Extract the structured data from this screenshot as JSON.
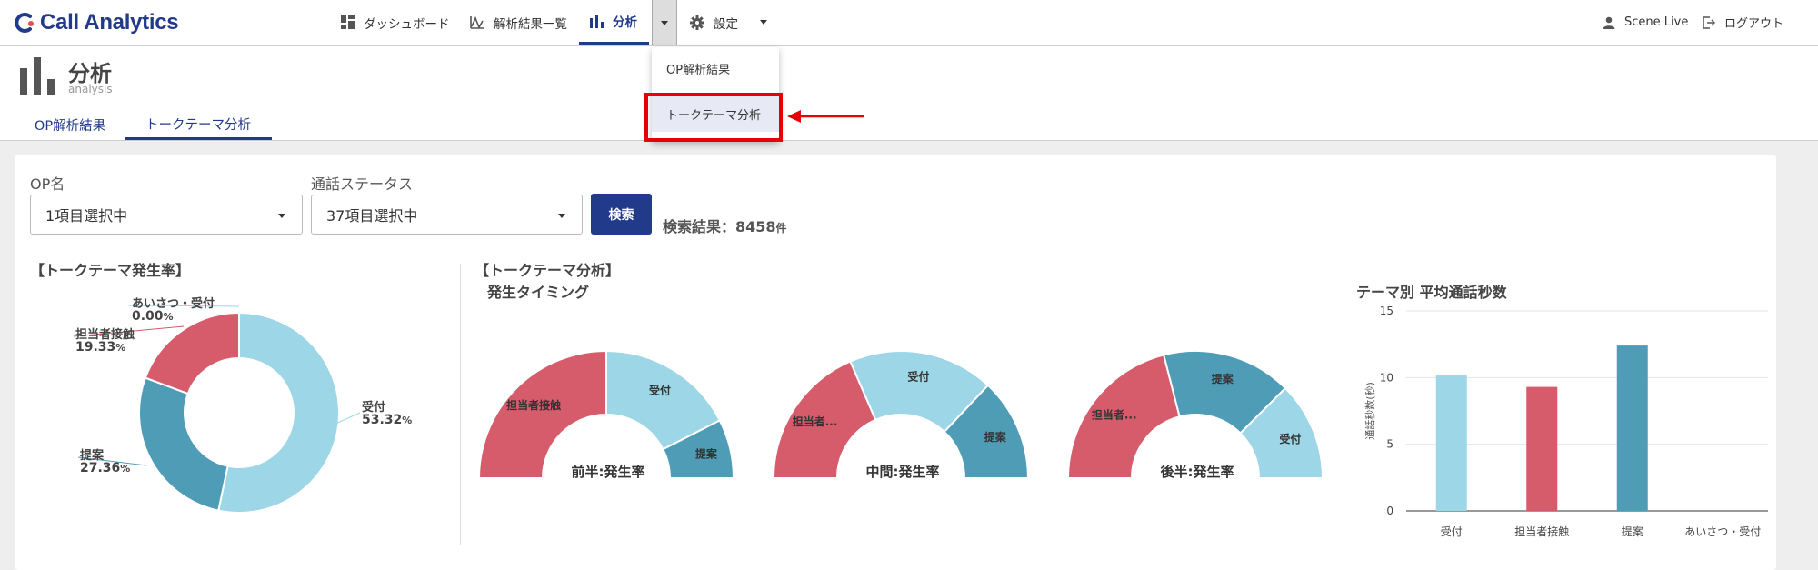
{
  "app": {
    "title": "Call Analytics"
  },
  "nav": {
    "items": [
      {
        "label": "ダッシュボード",
        "icon": "dashboard-icon"
      },
      {
        "label": "解析結果一覧",
        "icon": "line-chart-icon"
      },
      {
        "label": "分析",
        "icon": "bar-chart-icon",
        "active": true
      },
      {
        "label": "設定",
        "icon": "gear-icon"
      }
    ],
    "user": "Scene Live",
    "logout": "ログアウト"
  },
  "page": {
    "title": "分析",
    "subtitle": "analysis",
    "tabs": [
      {
        "label": "OP解析結果"
      },
      {
        "label": "トークテーマ分析",
        "active": true
      }
    ]
  },
  "dropdown": {
    "items": [
      {
        "label": "OP解析結果"
      },
      {
        "label": "トークテーマ分析",
        "selected": true
      }
    ]
  },
  "filters": {
    "op_label": "OP名",
    "op_value": "1項目選択中",
    "status_label": "通話ステータス",
    "status_value": "37項目選択中",
    "search_button": "検索",
    "result_prefix": "検索結果：",
    "result_count": "8458",
    "result_unit": "件"
  },
  "colors": {
    "accent": "#223a8a",
    "light_blue": "#9dd6e6",
    "red": "#d65c6b",
    "teal": "#4e9cb6",
    "highlight_red": "#e5000a"
  },
  "chart_data": [
    {
      "type": "pie",
      "title": "【トークテーマ発生率】",
      "donut": true,
      "slices": [
        {
          "name": "受付",
          "value": 53.32,
          "label": "53.32",
          "color": "#9dd6e6"
        },
        {
          "name": "提案",
          "value": 27.36,
          "label": "27.36",
          "color": "#4e9cb6"
        },
        {
          "name": "担当者接触",
          "value": 19.33,
          "label": "19.33",
          "color": "#d65c6b"
        },
        {
          "name": "あいさつ・受付",
          "value": 0.0,
          "label": "0.00",
          "color": "#9dd6e6"
        }
      ],
      "unit": "%"
    },
    {
      "type": "pie",
      "section_title": "【トークテーマ分析】",
      "title": "発生タイミング",
      "half_donut": true,
      "charts": [
        {
          "label": "前半:発生率",
          "slices": [
            {
              "name": "担当者接触",
              "label": "担当者接触",
              "value": 50,
              "color": "#d65c6b"
            },
            {
              "name": "受付",
              "label": "受付",
              "value": 35,
              "color": "#9dd6e6"
            },
            {
              "name": "提案",
              "label": "提案",
              "value": 15,
              "color": "#4e9cb6"
            }
          ]
        },
        {
          "label": "中間:発生率",
          "slices": [
            {
              "name": "担当者接触",
              "label": "担当者...",
              "value": 37,
              "color": "#d65c6b"
            },
            {
              "name": "受付",
              "label": "受付",
              "value": 37,
              "color": "#9dd6e6"
            },
            {
              "name": "提案",
              "label": "提案",
              "value": 26,
              "color": "#4e9cb6"
            }
          ]
        },
        {
          "label": "後半:発生率",
          "slices": [
            {
              "name": "担当者接触",
              "label": "担当者...",
              "value": 42,
              "color": "#d65c6b"
            },
            {
              "name": "提案",
              "label": "提案",
              "value": 33,
              "color": "#4e9cb6"
            },
            {
              "name": "受付",
              "label": "受付",
              "value": 25,
              "color": "#9dd6e6"
            }
          ]
        }
      ]
    },
    {
      "type": "bar",
      "title": "テーマ別 平均通話秒数",
      "ylabel": "通話秒数(秒)",
      "categories": [
        "受付",
        "担当者接触",
        "提案",
        "あいさつ・受付"
      ],
      "values": [
        10.2,
        9.3,
        12.4,
        0
      ],
      "colors": [
        "#9dd6e6",
        "#d65c6b",
        "#4e9cb6",
        "#9dd6e6"
      ],
      "ylim": [
        0,
        15
      ],
      "yticks": [
        "0",
        "5",
        "10",
        "15"
      ],
      "grid": true
    }
  ]
}
